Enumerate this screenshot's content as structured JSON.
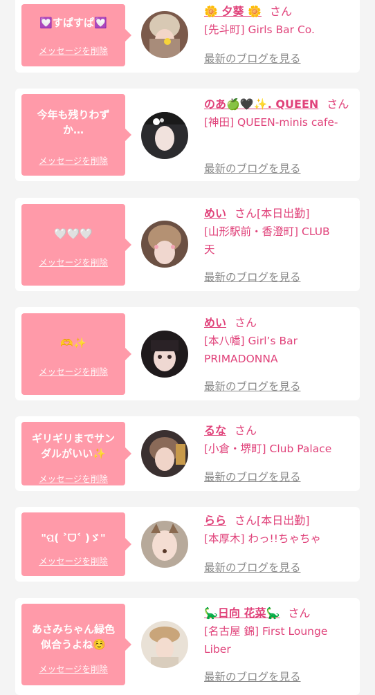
{
  "delete_label": "メッセージを削除",
  "blog_label": "最新のブログを見る",
  "san_label": "さん",
  "colors": {
    "accent": "#e0427a",
    "bubble": "#ff9aa9",
    "link_gray": "#8a8a8a"
  },
  "cards": [
    {
      "message": "💟すぱすぱ💟",
      "name": "🌼 夕葵 🌼",
      "status": "",
      "shop": "[先斗町] Girls Bar Co."
    },
    {
      "message": "今年も残りわず\nか…",
      "name": "のあ🍏🖤✨. QUEEN",
      "status": "",
      "shop": "[神田] QUEEN-minis cafe-"
    },
    {
      "message": "🤍🤍🤍",
      "name": "めい",
      "status": "[本日出勤]",
      "shop": "[山形駅前・香澄町] CLUB\n天"
    },
    {
      "message": "🫶✨",
      "name": "めい",
      "status": "",
      "shop": "[本八幡] Girl’s Bar\nPRIMADONNA"
    },
    {
      "message": "ギリギリまでサン\nダルがいい✨",
      "name": "るな",
      "status": "",
      "shop": "[小倉・堺町] Club Palace"
    },
    {
      "message": "\"ପ(  ˃ᗜ˂ )ゞ\"",
      "name": "らら",
      "status": "[本日出勤]",
      "shop": "[本厚木] わっ!!ちゃちゃ"
    },
    {
      "message": "あさみちゃん緑色\n似合うよね☺️",
      "name": "🦕日向 花菜🦕",
      "status": "",
      "shop": "[名古屋 錦] First Lounge\nLiber"
    }
  ]
}
